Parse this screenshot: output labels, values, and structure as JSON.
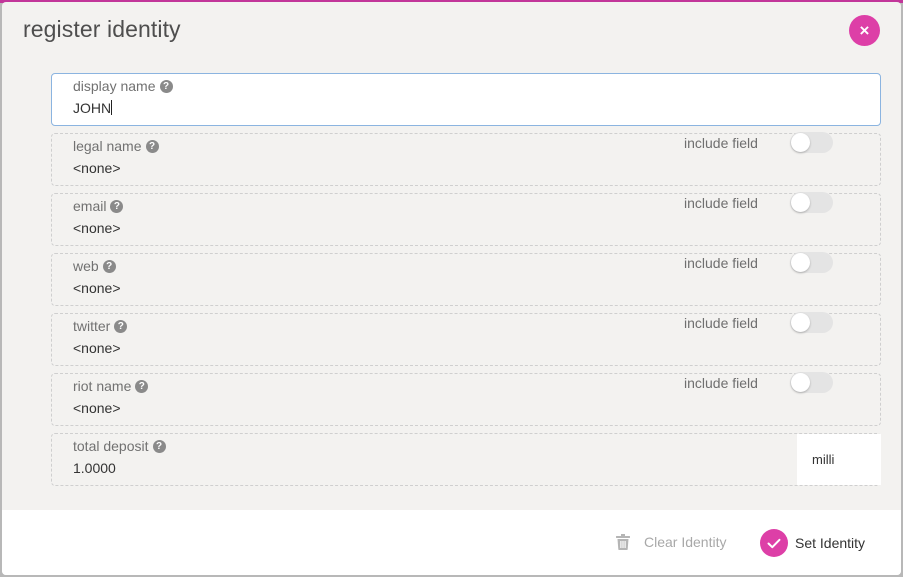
{
  "modal": {
    "title": "register identity",
    "close_label": "×"
  },
  "fields": {
    "display_name": {
      "label": "display name",
      "value": "JOHN"
    },
    "legal_name": {
      "label": "legal name",
      "value": "<none>",
      "include_label": "include field",
      "include": false
    },
    "email": {
      "label": "email",
      "value": "<none>",
      "include_label": "include field",
      "include": false
    },
    "web": {
      "label": "web",
      "value": "<none>",
      "include_label": "include field",
      "include": false
    },
    "twitter": {
      "label": "twitter",
      "value": "<none>",
      "include_label": "include field",
      "include": false
    },
    "riot_name": {
      "label": "riot name",
      "value": "<none>",
      "include_label": "include field",
      "include": false
    },
    "total_deposit": {
      "label": "total deposit",
      "value": "1.0000",
      "unit": "milli"
    }
  },
  "help_glyph": "?",
  "footer": {
    "clear_label": "Clear Identity",
    "set_label": "Set Identity"
  },
  "colors": {
    "accent": "#dd3fa7",
    "focus_border": "#8bb4e0"
  }
}
